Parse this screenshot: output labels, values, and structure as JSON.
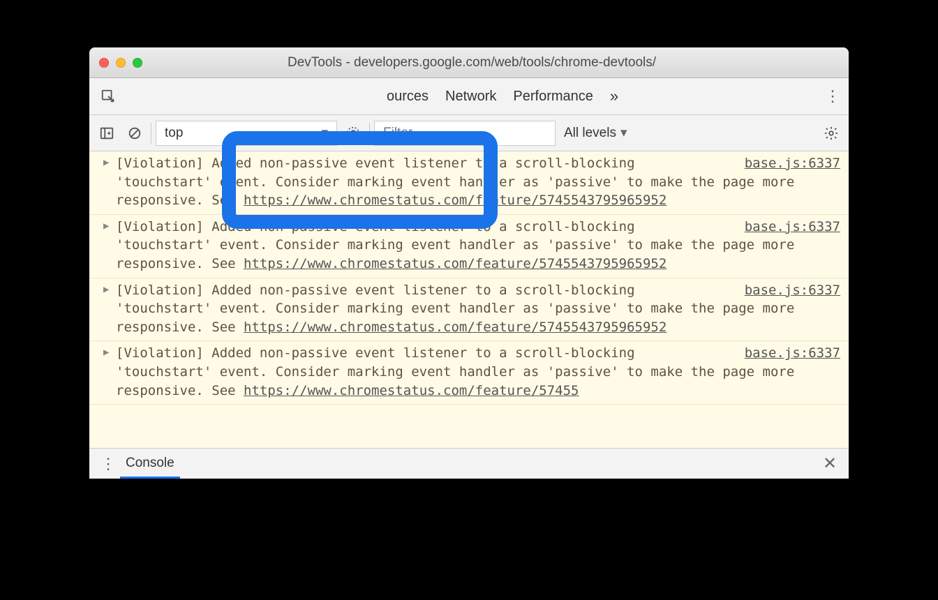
{
  "window": {
    "title": "DevTools - developers.google.com/web/tools/chrome-devtools/"
  },
  "tabs": {
    "sources": "ources",
    "network": "Network",
    "performance": "Performance",
    "more": "»"
  },
  "console_toolbar": {
    "context": "top",
    "filter_placeholder": "Filter",
    "levels_label": "All levels"
  },
  "messages": [
    {
      "prefix": "[Violation] ",
      "text_a": "Added non-passive event listener to a scroll-blocking 'touchstart' event. Consider marking event handler as 'passive' to make the page more responsive. See ",
      "link": "https://www.chromestatus.com/feature/5745543795965952",
      "source": "base.js:6337"
    },
    {
      "prefix": "[Violation] ",
      "text_a": "Added non-passive event listener to a scroll-blocking 'touchstart' event. Consider marking event handler as 'passive' to make the page more responsive. See ",
      "link": "https://www.chromestatus.com/feature/5745543795965952",
      "source": "base.js:6337"
    },
    {
      "prefix": "[Violation] ",
      "text_a": "Added non-passive event listener to a scroll-blocking 'touchstart' event. Consider marking event handler as 'passive' to make the page more responsive. See ",
      "link": "https://www.chromestatus.com/feature/5745543795965952",
      "source": "base.js:6337"
    },
    {
      "prefix": "[Violation] ",
      "text_a": "Added non-passive event listener to a scroll-blocking 'touchstart' event. Consider marking event handler as 'passive' to make the page more responsive. See ",
      "link": "https://www.chromestatus.com/feature/57455",
      "source": "base.js:6337"
    }
  ],
  "drawer": {
    "tab": "Console"
  }
}
